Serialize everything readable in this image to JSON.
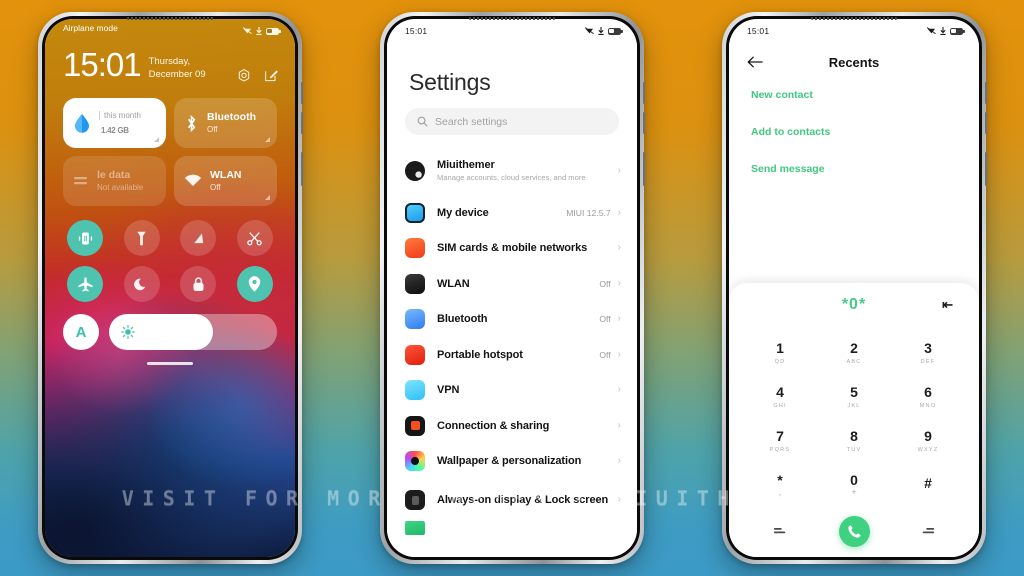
{
  "watermark": "VISIT FOR MORE THEMES - MIUITHEMER.COM",
  "background": {
    "top_color": "#E3920B",
    "bottom_color": "#3C9AC6"
  },
  "phone1": {
    "status": {
      "time_label": "Airplane mode",
      "icons": [
        "signal-off-icon",
        "download-icon",
        "battery-icon"
      ]
    },
    "clock": "15:01",
    "date": "Thursday, December 09",
    "actions": [
      "camera-icon",
      "edit-icon"
    ],
    "tiles": [
      {
        "name": "data-usage",
        "top": "this month",
        "value": "1.42",
        "unit": "GB",
        "style": "light"
      },
      {
        "name": "bluetooth",
        "title": "Bluetooth",
        "sub": "Off",
        "style": "glass"
      },
      {
        "name": "mobile-data",
        "title": "le data",
        "sub": "Not available",
        "style": "dim"
      },
      {
        "name": "wlan",
        "title": "WLAN",
        "sub": "Off",
        "style": "glass"
      }
    ],
    "toggles": [
      {
        "name": "vibrate",
        "state": "on"
      },
      {
        "name": "flashlight",
        "state": "off"
      },
      {
        "name": "screen-record",
        "state": "off"
      },
      {
        "name": "screenshot",
        "state": "off"
      },
      {
        "name": "airplane-mode",
        "state": "on"
      },
      {
        "name": "dark-mode",
        "state": "off"
      },
      {
        "name": "lock-screen",
        "state": "off"
      },
      {
        "name": "location",
        "state": "on"
      }
    ],
    "auto_brightness_label": "A",
    "brightness_percent": 62
  },
  "phone2": {
    "status": {
      "time": "15:01"
    },
    "title": "Settings",
    "search": {
      "placeholder": "Search settings"
    },
    "items": [
      {
        "title": "Miuithemer",
        "sub": "Manage accounts, cloud services, and more",
        "value": "",
        "icon": "account-avatar",
        "color": "#121212",
        "shape": "round"
      },
      {
        "title": "My device",
        "sub": "",
        "value": "MIUI 12.5.7",
        "icon": "device-icon",
        "color": "#2cb6f5",
        "shape": "square"
      },
      {
        "title": "SIM cards & mobile networks",
        "sub": "",
        "value": "",
        "icon": "sim-icon",
        "color": "#f2512c",
        "shape": "square"
      },
      {
        "title": "WLAN",
        "sub": "",
        "value": "Off",
        "icon": "wlan-icon",
        "color": "#1c1c1c",
        "shape": "square"
      },
      {
        "title": "Bluetooth",
        "sub": "",
        "value": "Off",
        "icon": "bluetooth-icon",
        "color": "#3b8ef5",
        "shape": "square"
      },
      {
        "title": "Portable hotspot",
        "sub": "",
        "value": "Off",
        "icon": "hotspot-icon",
        "color": "#f2301c",
        "shape": "square"
      },
      {
        "title": "VPN",
        "sub": "",
        "value": "",
        "icon": "vpn-icon",
        "color": "#3fcbf7",
        "shape": "square"
      },
      {
        "title": "Connection & sharing",
        "sub": "",
        "value": "",
        "icon": "connection-icon",
        "color": "#1c1c1c",
        "shape": "square"
      },
      {
        "title": "Wallpaper & personalization",
        "sub": "",
        "value": "",
        "icon": "wallpaper-icon",
        "color": "#1c1c1c",
        "shape": "square"
      },
      {
        "title": "Always-on display & Lock screen",
        "sub": "",
        "value": "",
        "icon": "aod-icon",
        "color": "#1c1c1c",
        "shape": "square"
      }
    ]
  },
  "phone3": {
    "status": {
      "time": "15:01"
    },
    "title": "Recents",
    "back_icon": "arrow-left-icon",
    "actions": [
      {
        "label": "New contact"
      },
      {
        "label": "Add to contacts"
      },
      {
        "label": "Send message"
      }
    ],
    "dialer": {
      "number": "*0*",
      "backspace_icon": "backspace-icon",
      "keys": [
        {
          "digit": "1",
          "letters": "QD"
        },
        {
          "digit": "2",
          "letters": "ABC"
        },
        {
          "digit": "3",
          "letters": "DEF"
        },
        {
          "digit": "4",
          "letters": "GHI"
        },
        {
          "digit": "5",
          "letters": "JKL"
        },
        {
          "digit": "6",
          "letters": "MNO"
        },
        {
          "digit": "7",
          "letters": "PQRS"
        },
        {
          "digit": "8",
          "letters": "TUV"
        },
        {
          "digit": "9",
          "letters": "WXYZ"
        },
        {
          "digit": "*",
          "letters": ","
        },
        {
          "digit": "0",
          "letters": "+"
        },
        {
          "digit": "#",
          "letters": ""
        }
      ],
      "bottom": [
        "keypad-hide-icon",
        "call-button",
        "keypad-hide-icon"
      ],
      "call_color": "#3FD182"
    }
  }
}
